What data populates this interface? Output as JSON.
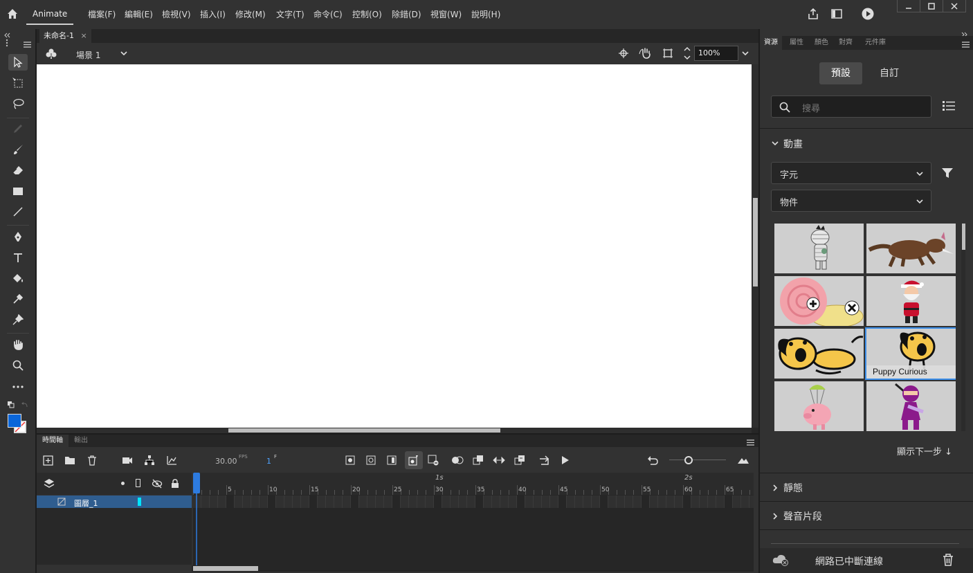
{
  "app": {
    "name": "Animate"
  },
  "menu": [
    "檔案(F)",
    "編輯(E)",
    "檢視(V)",
    "插入(I)",
    "修改(M)",
    "文字(T)",
    "命令(C)",
    "控制(O)",
    "除錯(D)",
    "視窗(W)",
    "說明(H)"
  ],
  "document": {
    "tab_title": "未命名-1",
    "close_glyph": "×",
    "scene": "場景 1",
    "zoom": "100%"
  },
  "timeline": {
    "tabs": [
      "時間軸",
      "輸出"
    ],
    "fps_value": "30.00",
    "fps_unit": "FPS",
    "frame_value": "1",
    "frame_unit": "F",
    "layer_name": "圖層_1",
    "ticks": [
      "5",
      "10",
      "15",
      "20",
      "25",
      "30",
      "35",
      "40",
      "45",
      "50",
      "55",
      "60",
      "65"
    ],
    "seconds": [
      "1s",
      "2s"
    ]
  },
  "panel": {
    "tabs": [
      "資源",
      "屬性",
      "顏色",
      "對齊",
      "元件庫"
    ],
    "segments": {
      "default": "預設",
      "custom": "自訂"
    },
    "search_placeholder": "搜尋",
    "section_animated": "動畫",
    "dropdown_characters": "字元",
    "dropdown_objects": "物件",
    "assets": [
      {
        "name": "mummy"
      },
      {
        "name": "wolf"
      },
      {
        "name": "snail"
      },
      {
        "name": "santa"
      },
      {
        "name": "puppy-lying"
      },
      {
        "name": "Puppy Curious",
        "caption": "Puppy Curious"
      },
      {
        "name": "pig-parachute"
      },
      {
        "name": "ninja"
      }
    ],
    "show_next": "顯示下一步 ↓",
    "section_static": "靜態",
    "section_sound": "聲音片段",
    "status": "網路已中斷連線"
  },
  "colors": {
    "accent": "#3b8ee8",
    "fill": "#0a66d9",
    "layer_marker": "#00e5ff",
    "playhead": "#2d7be0"
  }
}
